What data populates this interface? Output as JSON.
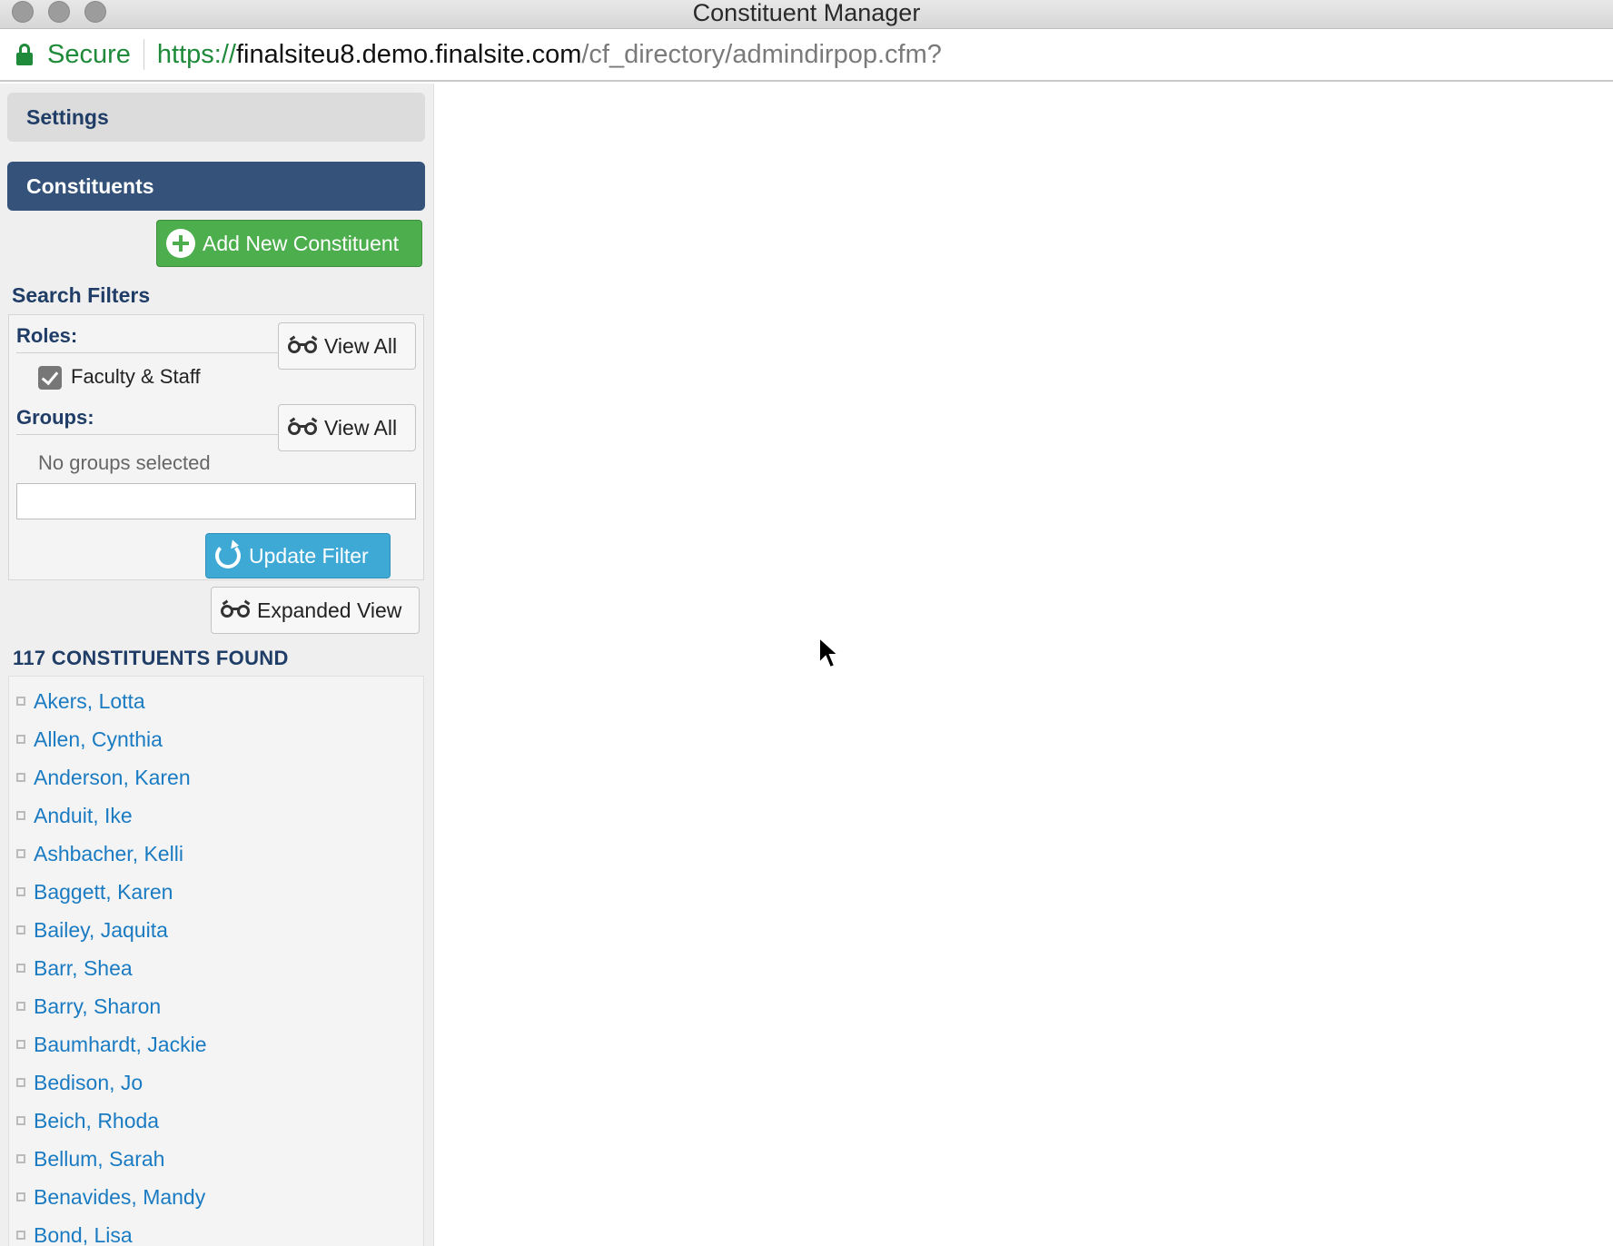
{
  "window": {
    "title": "Constituent Manager"
  },
  "address_bar": {
    "secure_label": "Secure",
    "url_scheme": "https://",
    "url_host": "finalsiteu8.demo.finalsite.com",
    "url_path": "/cf_directory/admindirpop.cfm?"
  },
  "sidebar": {
    "settings_label": "Settings",
    "constituents_label": "Constituents",
    "add_button_label": "Add New Constituent",
    "search_filters_title": "Search Filters",
    "roles_label": "Roles:",
    "roles_view_all_label": "View All",
    "role_option_label": "Faculty & Staff",
    "role_option_checked": true,
    "groups_label": "Groups:",
    "groups_view_all_label": "View All",
    "no_groups_text": "No groups selected",
    "filter_input_value": "",
    "update_button_label": "Update Filter",
    "expanded_view_label": "Expanded View",
    "found_text": "117 CONSTITUENTS FOUND",
    "constituents": [
      "Akers, Lotta",
      "Allen, Cynthia",
      "Anderson, Karen",
      "Anduit, Ike",
      "Ashbacher, Kelli",
      "Baggett, Karen",
      "Bailey, Jaquita",
      "Barr, Shea",
      "Barry, Sharon",
      "Baumhardt, Jackie",
      "Bedison, Jo",
      "Beich, Rhoda",
      "Bellum, Sarah",
      "Benavides, Mandy",
      "Bond, Lisa"
    ]
  },
  "colors": {
    "header_blue": "#34527a",
    "add_green": "#4cae4c",
    "update_blue": "#3fa9d6",
    "link_blue": "#1a7bc2",
    "secure_green": "#1e8a3a"
  }
}
